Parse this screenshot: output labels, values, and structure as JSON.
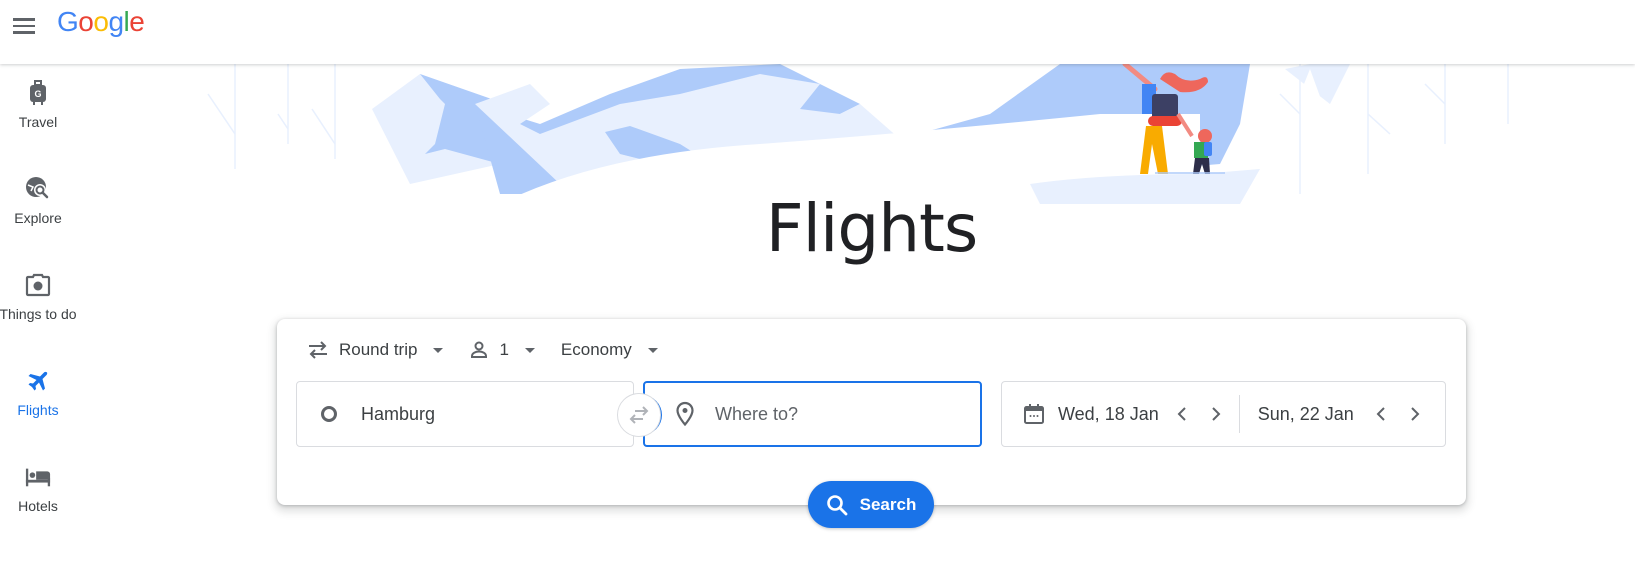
{
  "header": {
    "menu_icon": "hamburger-menu-icon",
    "logo": [
      "G",
      "o",
      "o",
      "g",
      "l",
      "e"
    ]
  },
  "sidebar": {
    "items": [
      {
        "label": "Travel",
        "icon": "luggage-icon",
        "active": false
      },
      {
        "label": "Explore",
        "icon": "explore-globe-icon",
        "active": false
      },
      {
        "label": "Things to do",
        "icon": "camera-icon",
        "active": false
      },
      {
        "label": "Flights",
        "icon": "airplane-icon",
        "active": true
      },
      {
        "label": "Hotels",
        "icon": "bed-icon",
        "active": false
      }
    ]
  },
  "main": {
    "title": "Flights",
    "colors": {
      "accent": "#1a73e8",
      "text": "#3c4043",
      "border": "#dadce0"
    }
  },
  "search": {
    "trip_type": "Round trip",
    "passengers": "1",
    "cabin_class": "Economy",
    "origin": "Hamburg",
    "destination_placeholder": "Where to?",
    "destination_value": "",
    "depart_date": "Wed, 18 Jan",
    "return_date": "Sun, 22 Jan",
    "search_label": "Search"
  }
}
